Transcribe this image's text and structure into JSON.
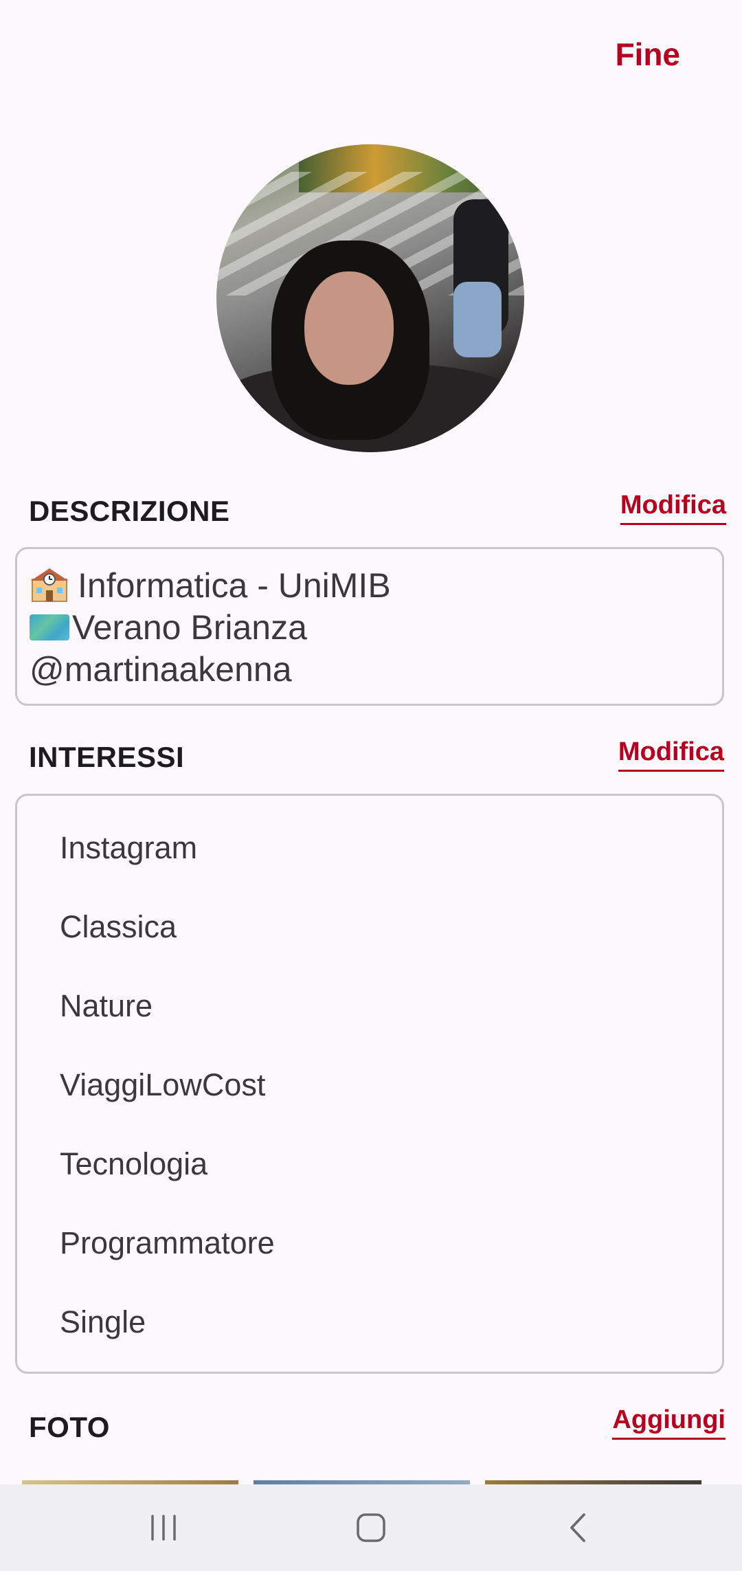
{
  "header": {
    "done_label": "Fine"
  },
  "description": {
    "title": "DESCRIZIONE",
    "action": "Modifica",
    "lines": [
      "Informatica - UniMIB",
      "Verano Brianza",
      "@martinaakenna"
    ]
  },
  "interests": {
    "title": "INTERESSI",
    "action": "Modifica",
    "items": [
      "Instagram",
      "Classica",
      "Nature",
      "ViaggiLowCost",
      "Tecnologia",
      "Programmatore",
      "Single"
    ]
  },
  "photos": {
    "title": "FOTO",
    "action": "Aggiungi"
  },
  "nav": {
    "recents_icon": "recents-icon",
    "home_icon": "home-icon",
    "back_icon": "back-icon"
  },
  "colors": {
    "accent": "#b7001f",
    "background": "#fdf8fb",
    "nav_background": "#f0eff1"
  }
}
